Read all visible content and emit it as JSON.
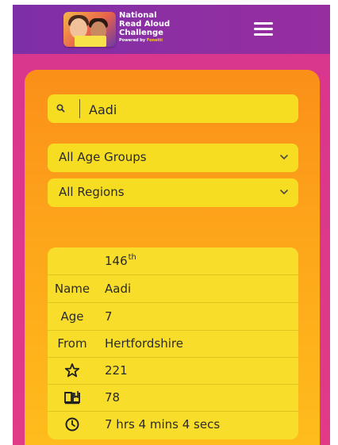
{
  "header": {
    "logo_line1": "National",
    "logo_line2": "Read Aloud",
    "logo_line3": "Challenge",
    "powered_prefix": "Powered by",
    "powered_brand": "Fonetti",
    "menu_icon": "hamburger-menu-icon"
  },
  "search": {
    "icon": "search-icon",
    "value": "Aadi"
  },
  "filters": {
    "age_group": "All Age Groups",
    "region": "All Regions"
  },
  "result": {
    "rank_number": "146",
    "rank_suffix": "th",
    "name_label": "Name",
    "name_value": "Aadi",
    "age_label": "Age",
    "age_value": "7",
    "from_label": "From",
    "from_value": "Hertfordshire",
    "stars_icon": "star-icon",
    "stars_value": "221",
    "books_icon": "book-icon",
    "books_value": "78",
    "time_icon": "clock-icon",
    "time_value": "7 hrs 4 mins 4 secs"
  },
  "colors": {
    "header": "#8a2fa3",
    "background": "#dd3789",
    "card_top": "#fb8f19",
    "card_bottom": "#ffbe1c",
    "field": "#f7dd22"
  }
}
